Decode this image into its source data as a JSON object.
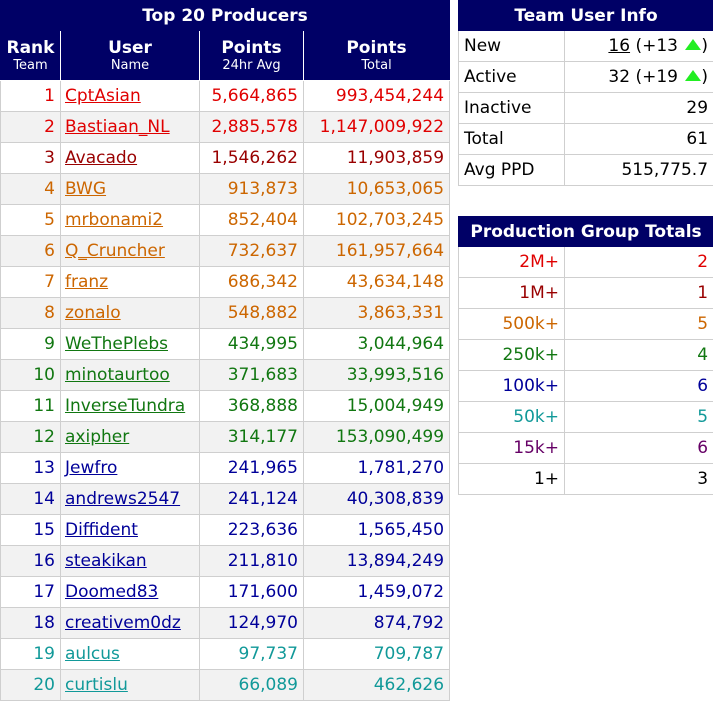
{
  "producers": {
    "title": "Top 20 Producers",
    "columns": [
      {
        "main": "Rank",
        "sub": "Team"
      },
      {
        "main": "User",
        "sub": "Name"
      },
      {
        "main": "Points",
        "sub": "24hr Avg"
      },
      {
        "main": "Points",
        "sub": "Total"
      }
    ],
    "rows": [
      {
        "rank": "1",
        "user": "CptAsian",
        "avg": "5,664,865",
        "total": "993,454,244",
        "tier": "c-red"
      },
      {
        "rank": "2",
        "user": "Bastiaan_NL",
        "avg": "2,885,578",
        "total": "1,147,009,922",
        "tier": "c-red"
      },
      {
        "rank": "3",
        "user": "Avacado",
        "avg": "1,546,262",
        "total": "11,903,859",
        "tier": "c-dred"
      },
      {
        "rank": "4",
        "user": "BWG",
        "avg": "913,873",
        "total": "10,653,065",
        "tier": "c-orange"
      },
      {
        "rank": "5",
        "user": "mrbonami2",
        "avg": "852,404",
        "total": "102,703,245",
        "tier": "c-orange"
      },
      {
        "rank": "6",
        "user": "Q_Cruncher",
        "avg": "732,637",
        "total": "161,957,664",
        "tier": "c-orange"
      },
      {
        "rank": "7",
        "user": "franz",
        "avg": "686,342",
        "total": "43,634,148",
        "tier": "c-orange"
      },
      {
        "rank": "8",
        "user": "zonalo",
        "avg": "548,882",
        "total": "3,863,331",
        "tier": "c-orange"
      },
      {
        "rank": "9",
        "user": "WeThePlebs",
        "avg": "434,995",
        "total": "3,044,964",
        "tier": "c-green"
      },
      {
        "rank": "10",
        "user": "minotaurtoo",
        "avg": "371,683",
        "total": "33,993,516",
        "tier": "c-green"
      },
      {
        "rank": "11",
        "user": "InverseTundra",
        "avg": "368,888",
        "total": "15,004,949",
        "tier": "c-green"
      },
      {
        "rank": "12",
        "user": "axipher",
        "avg": "314,177",
        "total": "153,090,499",
        "tier": "c-green"
      },
      {
        "rank": "13",
        "user": "Jewfro",
        "avg": "241,965",
        "total": "1,781,270",
        "tier": "c-blue"
      },
      {
        "rank": "14",
        "user": "andrews2547",
        "avg": "241,124",
        "total": "40,308,839",
        "tier": "c-blue"
      },
      {
        "rank": "15",
        "user": "Diffident",
        "avg": "223,636",
        "total": "1,565,450",
        "tier": "c-blue"
      },
      {
        "rank": "16",
        "user": "steakikan",
        "avg": "211,810",
        "total": "13,894,249",
        "tier": "c-blue"
      },
      {
        "rank": "17",
        "user": "Doomed83",
        "avg": "171,600",
        "total": "1,459,072",
        "tier": "c-blue"
      },
      {
        "rank": "18",
        "user": "creativem0dz",
        "avg": "124,970",
        "total": "874,792",
        "tier": "c-blue"
      },
      {
        "rank": "19",
        "user": "aulcus",
        "avg": "97,737",
        "total": "709,787",
        "tier": "c-teal"
      },
      {
        "rank": "20",
        "user": "curtislu",
        "avg": "66,089",
        "total": "462,626",
        "tier": "c-teal"
      }
    ]
  },
  "team_info": {
    "title": "Team User Info",
    "new": {
      "label": "New",
      "value": "16",
      "delta": "(+13"
    },
    "active": {
      "label": "Active",
      "value": "32",
      "delta": "(+19"
    },
    "inactive": {
      "label": "Inactive",
      "value": "29"
    },
    "total": {
      "label": "Total",
      "value": "61"
    },
    "avg_ppd": {
      "label": "Avg PPD",
      "value": "515,775.7"
    },
    "delta_close": ")",
    "up_icon": "up-triangle-icon",
    "up_color": "#22ee22"
  },
  "groups": {
    "title": "Production Group Totals",
    "rows": [
      {
        "label": "2M+",
        "count": "2",
        "tier": "c-red"
      },
      {
        "label": "1M+",
        "count": "1",
        "tier": "c-dred"
      },
      {
        "label": "500k+",
        "count": "5",
        "tier": "c-orange"
      },
      {
        "label": "250k+",
        "count": "4",
        "tier": "c-green"
      },
      {
        "label": "100k+",
        "count": "6",
        "tier": "c-blue"
      },
      {
        "label": "50k+",
        "count": "5",
        "tier": "c-teal"
      },
      {
        "label": "15k+",
        "count": "6",
        "tier": "c-purple"
      },
      {
        "label": "1+",
        "count": "3",
        "tier": "c-black"
      }
    ]
  },
  "colors": {
    "header_bg": "#000066",
    "c-red": "#e00000",
    "c-dred": "#990000",
    "c-orange": "#cc6600",
    "c-green": "#117711",
    "c-blue": "#000099",
    "c-teal": "#119999",
    "c-purple": "#660066",
    "c-black": "#000000"
  }
}
